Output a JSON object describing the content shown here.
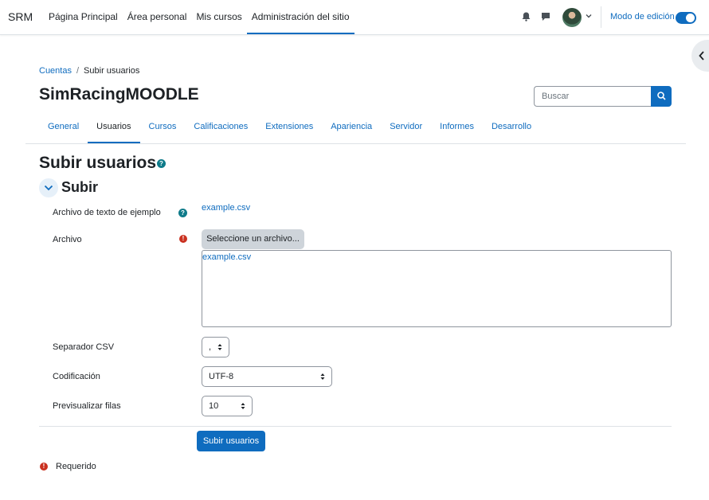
{
  "navbar": {
    "brand": "SRM",
    "items": [
      {
        "label": "Página Principal",
        "active": false
      },
      {
        "label": "Área personal",
        "active": false
      },
      {
        "label": "Mis cursos",
        "active": false
      },
      {
        "label": "Administración del sitio",
        "active": true
      }
    ],
    "icons": [
      "bell-icon",
      "chat-icon",
      "avatar",
      "chevron-down-icon"
    ],
    "edit_mode_label": "Modo de edición",
    "edit_mode_on": true
  },
  "breadcrumb": {
    "items": [
      "Cuentas",
      "Subir usuarios"
    ]
  },
  "site_title": "SimRacingMOODLE",
  "search": {
    "placeholder": "Buscar"
  },
  "secondary_nav": {
    "items": [
      {
        "label": "General",
        "active": false
      },
      {
        "label": "Usuarios",
        "active": true
      },
      {
        "label": "Cursos",
        "active": false
      },
      {
        "label": "Calificaciones",
        "active": false
      },
      {
        "label": "Extensiones",
        "active": false
      },
      {
        "label": "Apariencia",
        "active": false
      },
      {
        "label": "Servidor",
        "active": false
      },
      {
        "label": "Informes",
        "active": false
      },
      {
        "label": "Desarrollo",
        "active": false
      }
    ]
  },
  "page_heading": "Subir usuarios",
  "section_title": "Subir",
  "form": {
    "example_label": "Archivo de texto de ejemplo",
    "example_link": "example.csv",
    "file_label": "Archivo",
    "file_button": "Seleccione un archivo...",
    "file_selected": "example.csv",
    "separator_label": "Separador CSV",
    "separator_value": ",",
    "encoding_label": "Codificación",
    "encoding_value": "UTF-8",
    "preview_label": "Previsualizar filas",
    "preview_value": "10",
    "submit_label": "Subir usuarios",
    "required_note": "Requerido"
  },
  "colors": {
    "accent": "#0f6cbf",
    "required": "#ca3120",
    "help": "#0f7b8a"
  }
}
